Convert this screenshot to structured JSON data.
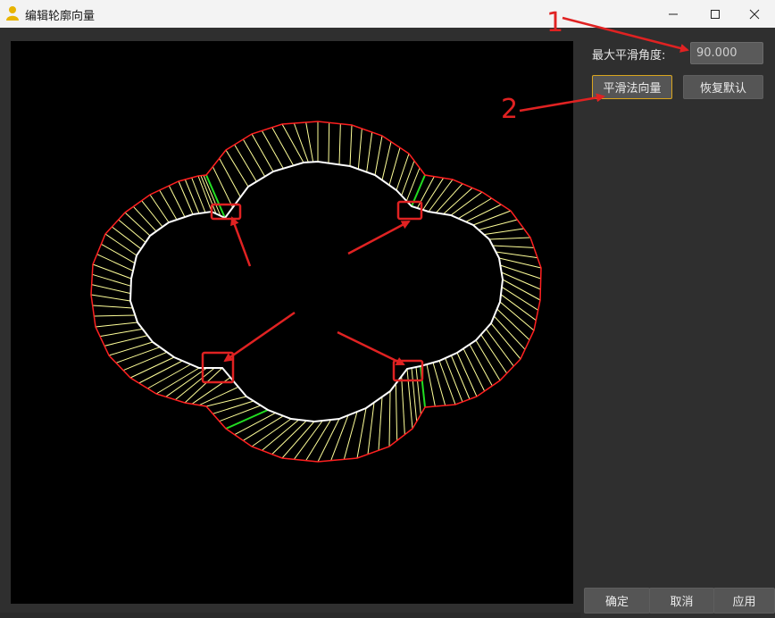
{
  "window": {
    "title": "编辑轮廓向量",
    "app_icon": "user-icon",
    "controls": [
      "minimize-icon",
      "maximize-icon",
      "close-icon"
    ]
  },
  "settings": {
    "max_smooth_angle_label": "最大平滑角度:",
    "max_smooth_angle_value": "90.000",
    "smooth_normals_button": "平滑法向量",
    "restore_default_button": "恢复默认"
  },
  "footer": {
    "ok_button": "确定",
    "cancel_button": "取消",
    "apply_button": "应用"
  },
  "annotations": {
    "label_1": "1",
    "label_2": "2",
    "color": "#e02222"
  },
  "viewport": {
    "background": "#000000",
    "outer_contour_color": "#ff2020",
    "inner_contour_color": "#ffffff",
    "normal_color": "#ffff99",
    "corner_normal_color": "#22dd22"
  }
}
